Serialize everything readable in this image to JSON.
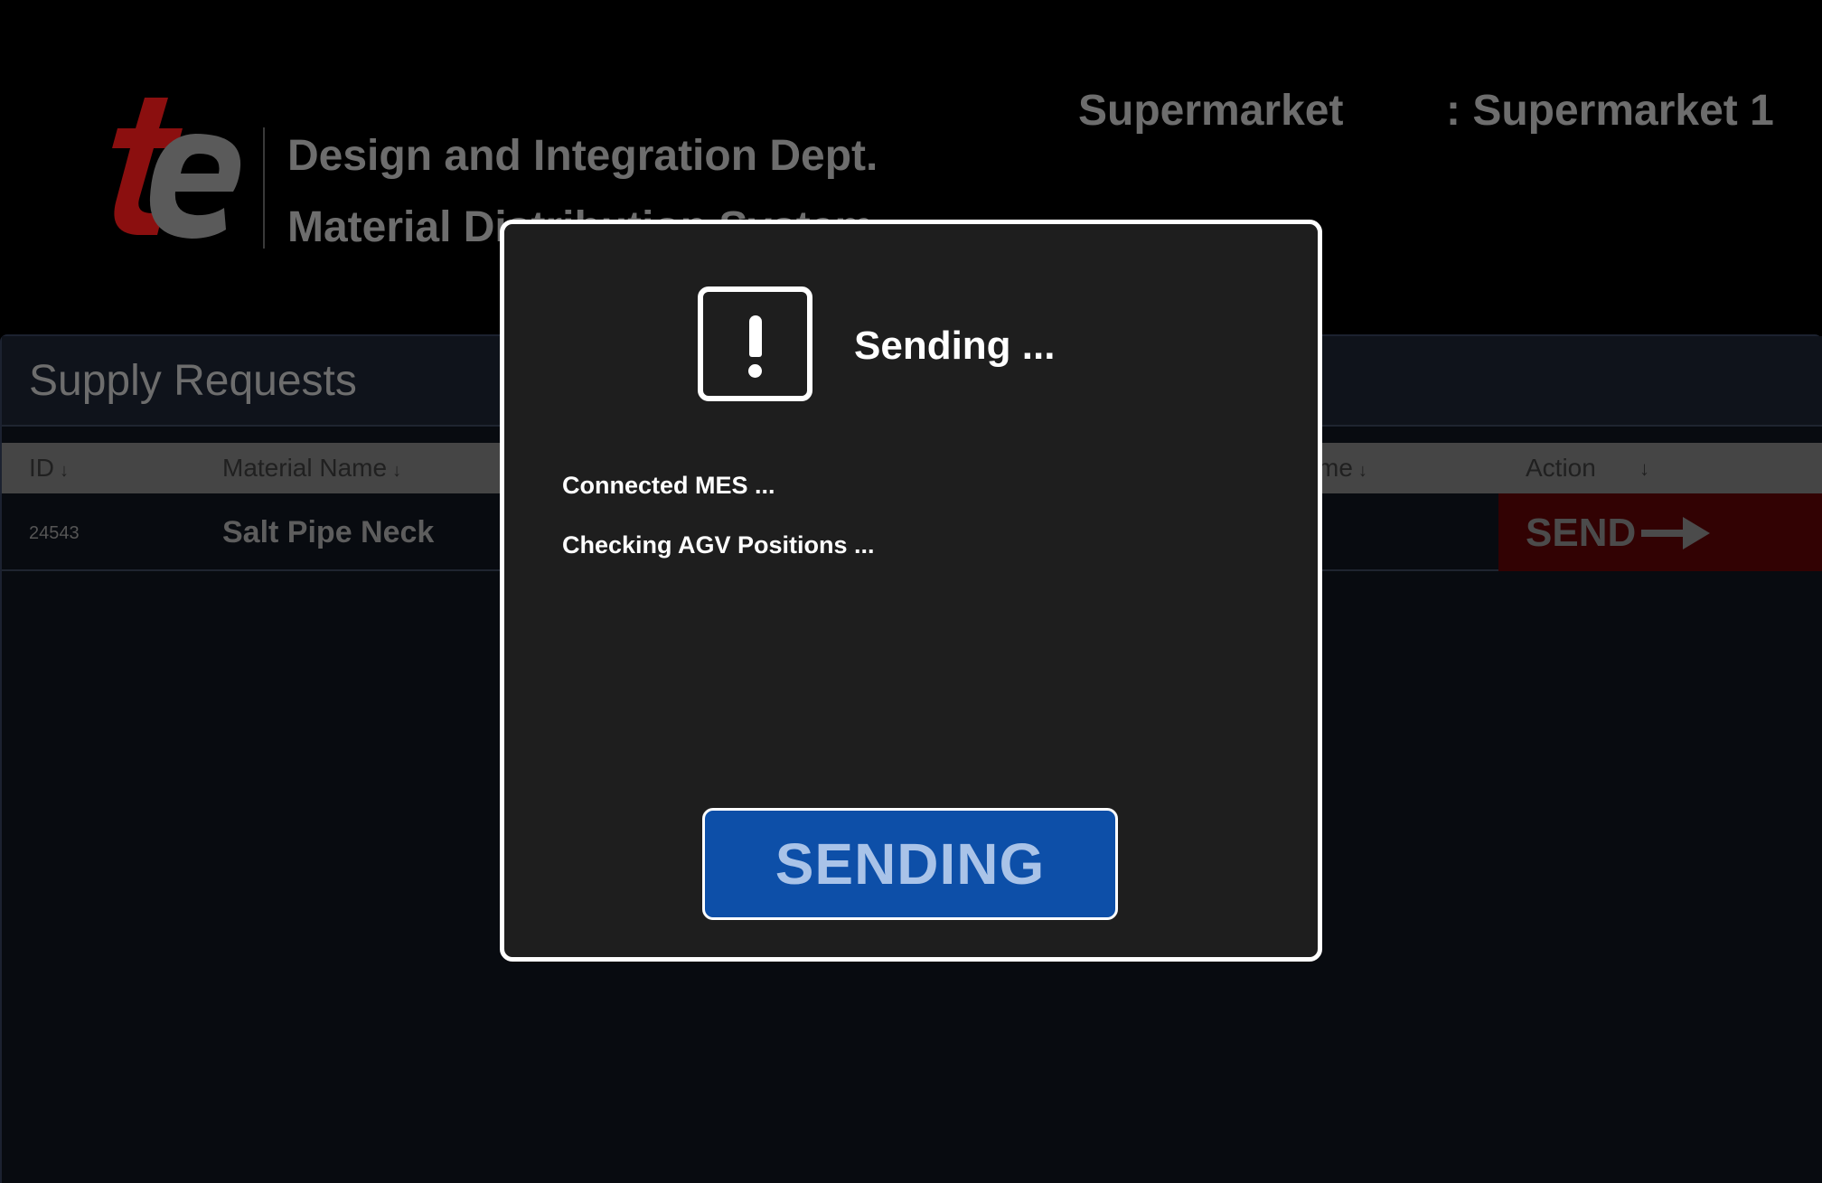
{
  "header": {
    "logo_text": "te",
    "dept_line1": "Design and Integration Dept.",
    "dept_line2": "Material Distribution System",
    "supermarket_label": "Supermarket",
    "supermarket_value": ": Supermarket 1"
  },
  "panel": {
    "title": "Supply Requests",
    "columns": {
      "id": "ID",
      "material": "Material Name",
      "partial_hidden": "me",
      "action": "Action"
    },
    "sort_arrow": "↓",
    "rows": [
      {
        "id": "24543",
        "material": "Salt Pipe Neck",
        "action_label": "SEND"
      }
    ]
  },
  "modal": {
    "title": "Sending ...",
    "status_lines": [
      "Connected MES ...",
      "Checking AGV Positions ..."
    ],
    "button_label": "SENDING"
  },
  "colors": {
    "brand_red": "#8b0f0f",
    "modal_button_blue": "#0d4fa8",
    "send_button_bg": "#320203"
  },
  "icons": {
    "alert": "exclamation-square-icon",
    "send_arrow": "arrow-right-icon",
    "sort": "arrow-down-icon"
  }
}
